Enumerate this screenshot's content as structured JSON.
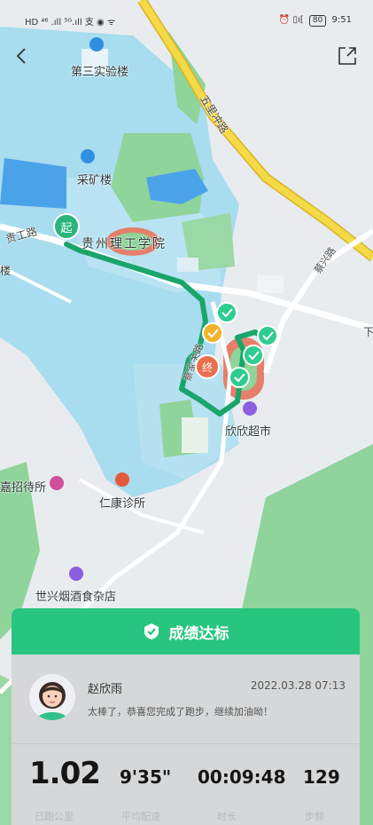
{
  "status_bar": {
    "left": "HD  ⁴⁶ .ıll  ⁵ᴳ.ıll  支  ◉  ᯤ",
    "right_icons": "⏰ ▯ı[",
    "battery": "80",
    "time": "9:51"
  },
  "map": {
    "labels": {
      "building1": "第三实验楼",
      "building2": "采矿楼",
      "road1": "五里冲路",
      "road2": "贵工路",
      "campus": "贵州理工学院",
      "left_edge": "楼",
      "road3": "蔡家关路",
      "market": "欣欣超市",
      "hostel": "嘉招待所",
      "clinic": "仁康诊所",
      "shop": "世兴烟酒食杂店",
      "road4": "蔡兴路",
      "right_edge": "下"
    },
    "start_marker": "起",
    "end_marker": "终"
  },
  "panel": {
    "banner": "成绩达标",
    "name": "赵欣雨",
    "datetime": "2022.03.28 07:13",
    "message": "太棒了，恭喜您完成了跑步，继续加油呦！",
    "stats": [
      {
        "value": "1.02",
        "label": "已跑公里"
      },
      {
        "value": "9'35\"",
        "label": "平均配速"
      },
      {
        "value": "00:09:48",
        "label": "时长"
      },
      {
        "value": "129",
        "label": "步频"
      }
    ]
  },
  "colors": {
    "accent": "#27c57f",
    "route": "#1aa56a",
    "water": "#a8dcef",
    "green": "#8fd49a",
    "road": "#f2d13a"
  }
}
